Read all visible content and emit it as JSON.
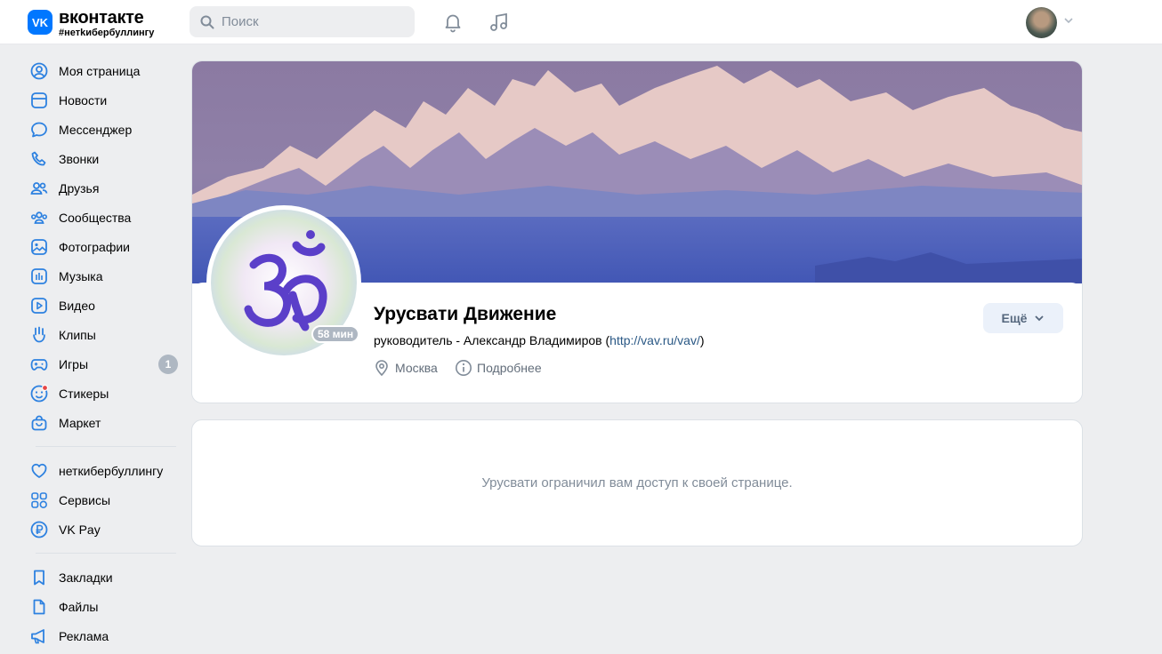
{
  "header": {
    "logo_mark": "VK",
    "logo_name": "вконтакте",
    "logo_tag": "#нетkибербуллингу",
    "search_placeholder": "Поиск",
    "icons": [
      "search-icon",
      "bell-icon",
      "music-icon",
      "chevron-down-icon"
    ]
  },
  "sidebar": {
    "items": [
      {
        "label": "Моя страница",
        "icon": "user-circle-icon"
      },
      {
        "label": "Новости",
        "icon": "news-icon"
      },
      {
        "label": "Мессенджер",
        "icon": "message-icon"
      },
      {
        "label": "Звонки",
        "icon": "phone-icon"
      },
      {
        "label": "Друзья",
        "icon": "users-icon"
      },
      {
        "label": "Сообщества",
        "icon": "community-icon"
      },
      {
        "label": "Фотографии",
        "icon": "photo-icon"
      },
      {
        "label": "Музыка",
        "icon": "music-icon"
      },
      {
        "label": "Видео",
        "icon": "video-icon"
      },
      {
        "label": "Клипы",
        "icon": "clips-icon"
      },
      {
        "label": "Игры",
        "icon": "gamepad-icon",
        "badge": "1"
      },
      {
        "label": "Стикеры",
        "icon": "sticker-icon"
      },
      {
        "label": "Маркет",
        "icon": "market-icon"
      }
    ],
    "items2": [
      {
        "label": "неткибербуллингу",
        "icon": "heart-icon"
      },
      {
        "label": "Сервисы",
        "icon": "services-icon"
      },
      {
        "label": "VK Pay",
        "icon": "vkpay-icon"
      }
    ],
    "items3": [
      {
        "label": "Закладки",
        "icon": "bookmark-icon"
      },
      {
        "label": "Файлы",
        "icon": "file-icon"
      },
      {
        "label": "Реклама",
        "icon": "megaphone-icon"
      }
    ]
  },
  "group": {
    "title": "Урусвати Движение",
    "status_prefix": "руководитель - Александр Владимиров (",
    "status_link": "http://vav.ru/vav/",
    "status_suffix": ")",
    "online": "58 мин",
    "city": "Москва",
    "details": "Подробнее",
    "more_button": "Ещё"
  },
  "blocked": {
    "message": "Урусвати ограничил вам доступ к своей странице."
  },
  "colors": {
    "accent": "#0077ff",
    "background": "#edeef0",
    "icon": "#2d81e0",
    "link": "#2a5885",
    "secondary_text": "#818c99"
  }
}
